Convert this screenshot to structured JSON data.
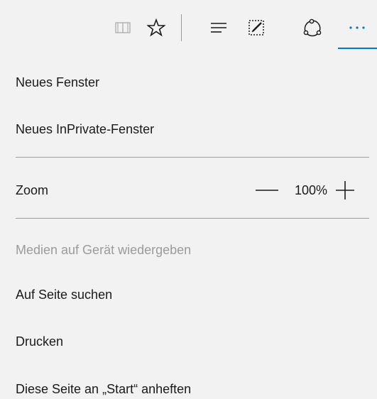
{
  "toolbar": {
    "icons": [
      "reading-view-icon",
      "favorite-star-icon",
      "hub-icon",
      "web-note-icon",
      "share-icon",
      "more-icon"
    ],
    "accent_color": "#0078d7"
  },
  "menu": {
    "new_window": "Neues Fenster",
    "new_inprivate": "Neues InPrivate-Fenster",
    "zoom_label": "Zoom",
    "zoom_value": "100%",
    "cast_media": "Medien auf Gerät wiedergeben",
    "find_on_page": "Auf Seite suchen",
    "print": "Drucken",
    "pin_to_start": "Diese Seite an „Start“ anheften"
  }
}
